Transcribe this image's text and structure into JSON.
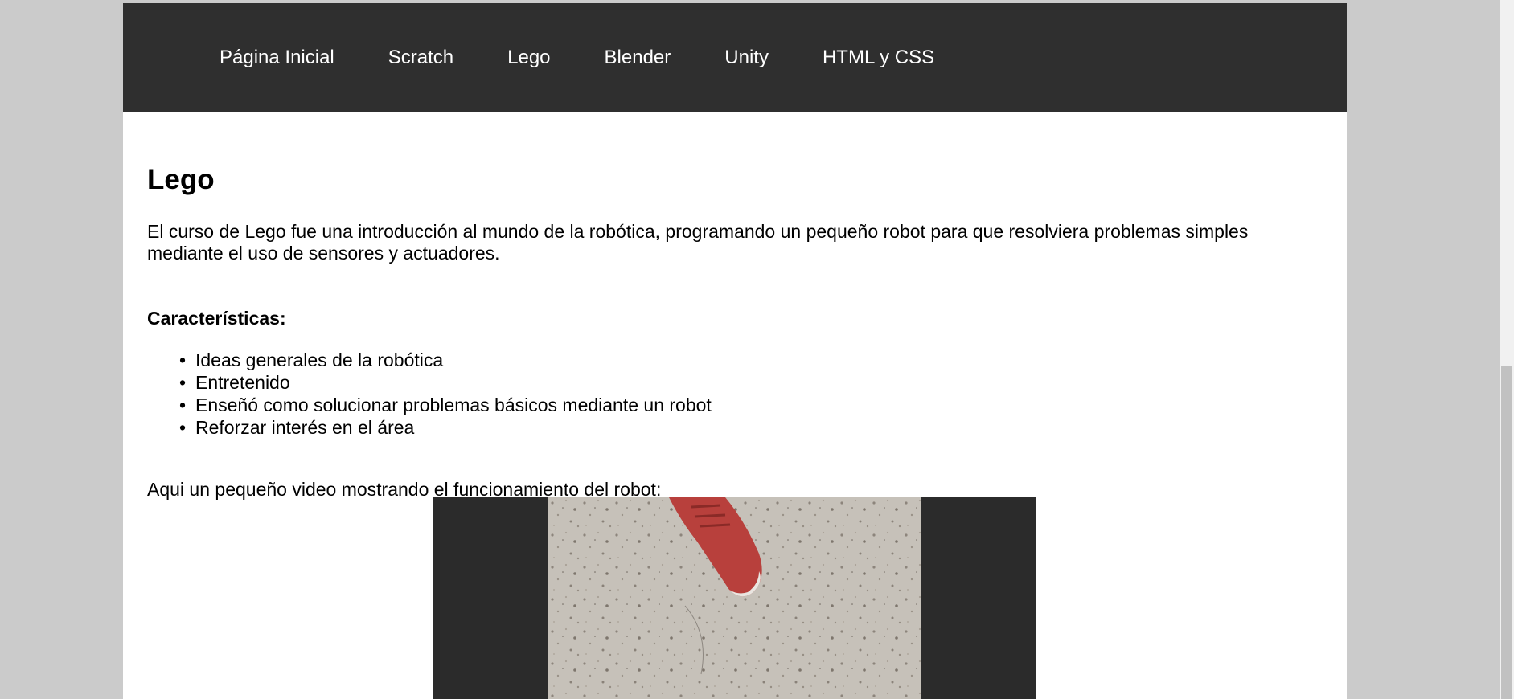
{
  "nav": {
    "items": [
      {
        "label": "Página Inicial"
      },
      {
        "label": "Scratch"
      },
      {
        "label": "Lego"
      },
      {
        "label": "Blender"
      },
      {
        "label": "Unity"
      },
      {
        "label": "HTML y CSS"
      }
    ]
  },
  "main": {
    "title": "Lego",
    "intro": "El curso de Lego fue una introducción al mundo de la robótica, programando un pequeño robot para que resolviera problemas simples mediante el uso de sensores y actuadores.",
    "features_title": "Características:",
    "features": [
      "Ideas generales de la robótica",
      "Entretenido",
      "Enseñó como solucionar problemas básicos mediante un robot",
      "Reforzar interés en el área"
    ],
    "video_caption": "Aqui un pequeño video mostrando el funcionamiento del robot:"
  },
  "colors": {
    "page_background": "#cbcbcb",
    "navbar": "#2f2f2f",
    "content_background": "#ffffff",
    "video_letterbox": "#2b2b2b"
  }
}
